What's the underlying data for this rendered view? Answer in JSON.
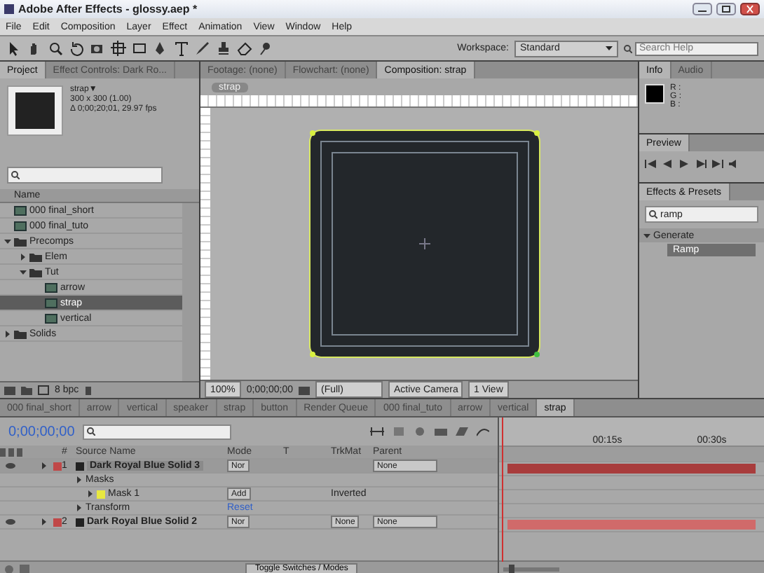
{
  "window": {
    "title": "Adobe After Effects - glossy.aep *"
  },
  "menu": [
    "File",
    "Edit",
    "Composition",
    "Layer",
    "Effect",
    "Animation",
    "View",
    "Window",
    "Help"
  ],
  "toolbar": {
    "workspace_label": "Workspace:",
    "workspace": "Standard",
    "search_placeholder": "Search Help"
  },
  "project": {
    "tabs": [
      {
        "label": "Project",
        "selected": true
      },
      {
        "label": "Effect Controls: Dark Ro...",
        "selected": false
      }
    ],
    "item_name": "strap▼",
    "item_size": "300 x 300 (1.00)",
    "item_duration": "Δ 0;00;20;01, 29.97 fps",
    "column": "Name",
    "bpc": "8 bpc",
    "tree": [
      {
        "name": "000 final_short",
        "kind": "comp",
        "selected": false
      },
      {
        "name": "000 final_tuto",
        "kind": "comp",
        "selected": false
      },
      {
        "name": "Precomps",
        "kind": "folder",
        "expanded": true,
        "selected": false,
        "children": [
          {
            "name": "Elem",
            "kind": "folder",
            "expanded": false,
            "selected": false
          },
          {
            "name": "Tut",
            "kind": "folder",
            "expanded": true,
            "selected": false,
            "children": [
              {
                "name": "arrow",
                "kind": "comp",
                "selected": false
              },
              {
                "name": "strap",
                "kind": "comp",
                "selected": true
              },
              {
                "name": "vertical",
                "kind": "comp",
                "selected": false
              }
            ]
          }
        ]
      },
      {
        "name": "Solids",
        "kind": "folder",
        "expanded": false,
        "selected": false
      }
    ]
  },
  "composition": {
    "tabs": [
      {
        "label": "Footage: (none)",
        "selected": false
      },
      {
        "label": "Flowchart: (none)",
        "selected": false
      },
      {
        "label": "Composition: strap",
        "selected": true
      }
    ],
    "subtab": "strap",
    "zoom": "100%",
    "timecode": "0;00;00;00",
    "resolution": "(Full)",
    "camera": "Active Camera",
    "views": "1 View"
  },
  "info": {
    "tabs": [
      {
        "label": "Info",
        "selected": true
      },
      {
        "label": "Audio",
        "selected": false
      }
    ],
    "channels": [
      "R :",
      "G :",
      "B :"
    ]
  },
  "preview": {
    "tab": "Preview"
  },
  "effects": {
    "tab": "Effects & Presets",
    "search": "ramp",
    "category": "Generate",
    "expanded": true,
    "items": [
      {
        "name": "Ramp",
        "selected": true
      }
    ]
  },
  "timeline": {
    "tabs": [
      {
        "label": "000 final_short",
        "selected": false
      },
      {
        "label": "arrow",
        "selected": false
      },
      {
        "label": "vertical",
        "selected": false
      },
      {
        "label": "speaker",
        "selected": false
      },
      {
        "label": "strap",
        "selected": false
      },
      {
        "label": "button",
        "selected": false
      },
      {
        "label": "Render Queue",
        "selected": false
      },
      {
        "label": "000 final_tuto",
        "selected": false
      },
      {
        "label": "arrow",
        "selected": false
      },
      {
        "label": "vertical",
        "selected": false
      },
      {
        "label": "strap",
        "selected": true
      }
    ],
    "timecode": "0;00;00;00",
    "columns": [
      "#",
      "Source Name",
      "Mode",
      "T",
      "TrkMat",
      "Parent"
    ],
    "ruler": [
      "00:15s",
      "00:30s"
    ],
    "rows": [
      {
        "kind": "layer",
        "index": "1",
        "name": "Dark Royal Blue Solid 3",
        "mode": "Nor",
        "parent": "None",
        "selected": true,
        "color": "#c04848"
      },
      {
        "kind": "group",
        "name": "Masks"
      },
      {
        "kind": "mask",
        "name": "Mask 1",
        "mode": "Add",
        "inverted": "Inverted"
      },
      {
        "kind": "group",
        "name": "Transform",
        "link": "Reset"
      },
      {
        "kind": "layer",
        "index": "2",
        "name": "Dark Royal Blue Solid 2",
        "mode": "Nor",
        "trkmat": "None",
        "parent": "None",
        "selected": false,
        "color": "#c04848"
      }
    ],
    "toggle": "Toggle Switches / Modes",
    "zoom_slider": {
      "level": 0.1
    }
  }
}
